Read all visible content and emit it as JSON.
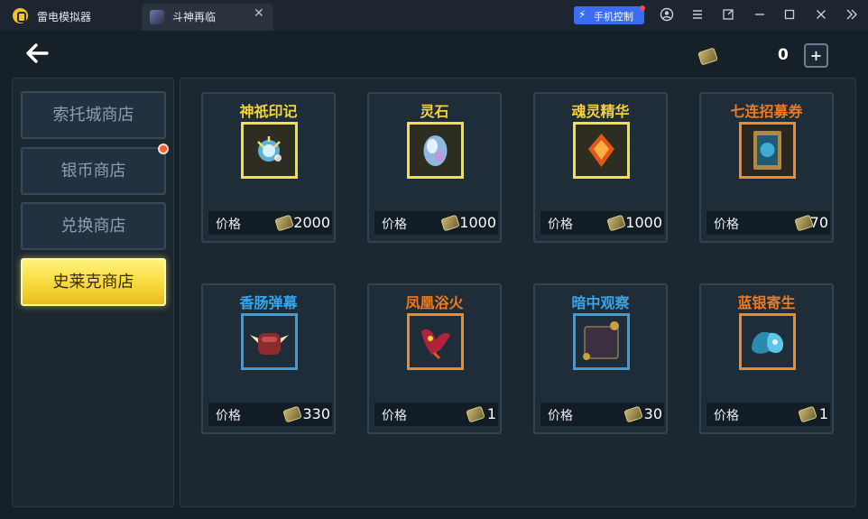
{
  "titlebar": {
    "app_name": "雷电模拟器",
    "tab_label": "斗神再临",
    "tab_close": "✕",
    "phone_control_label": "手机控制",
    "phone_control_icon": "⚡"
  },
  "header": {
    "back_icon": "←",
    "currency_value": "0",
    "add_label": "+"
  },
  "sidebar": {
    "items": [
      {
        "label": "索托城商店"
      },
      {
        "label": "银币商店"
      },
      {
        "label": "兑换商店"
      },
      {
        "label": "史莱克商店"
      }
    ]
  },
  "shop": {
    "price_label": "价格",
    "items": [
      {
        "name": "神祇印记",
        "price": "2000",
        "name_color": "#f5d23b",
        "frame_color": "#f2e23a",
        "icon": "deity-seal-icon"
      },
      {
        "name": "灵石",
        "price": "1000",
        "name_color": "#f5d23b",
        "frame_color": "#f2e23a",
        "icon": "spirit-stone-icon"
      },
      {
        "name": "魂灵精华",
        "price": "1000",
        "name_color": "#f5d23b",
        "frame_color": "#f2e23a",
        "icon": "soul-essence-icon"
      },
      {
        "name": "七连招募券",
        "price": "70",
        "name_color": "#f07a22",
        "frame_color": "#f08a2a",
        "icon": "recruit-ticket-icon"
      },
      {
        "name": "香肠弹幕",
        "price": "330",
        "name_color": "#3aa4e8",
        "frame_color": "#3a9de0",
        "icon": "sausage-barrage-icon"
      },
      {
        "name": "凤凰浴火",
        "price": "1",
        "name_color": "#f07a22",
        "frame_color": "#f08a2a",
        "icon": "phoenix-fire-icon"
      },
      {
        "name": "暗中观察",
        "price": "30",
        "name_color": "#3aa4e8",
        "frame_color": "#3a9de0",
        "icon": "secret-watch-icon"
      },
      {
        "name": "蓝银寄生",
        "price": "1",
        "name_color": "#f07a22",
        "frame_color": "#f08a2a",
        "icon": "blue-silver-icon"
      }
    ]
  }
}
